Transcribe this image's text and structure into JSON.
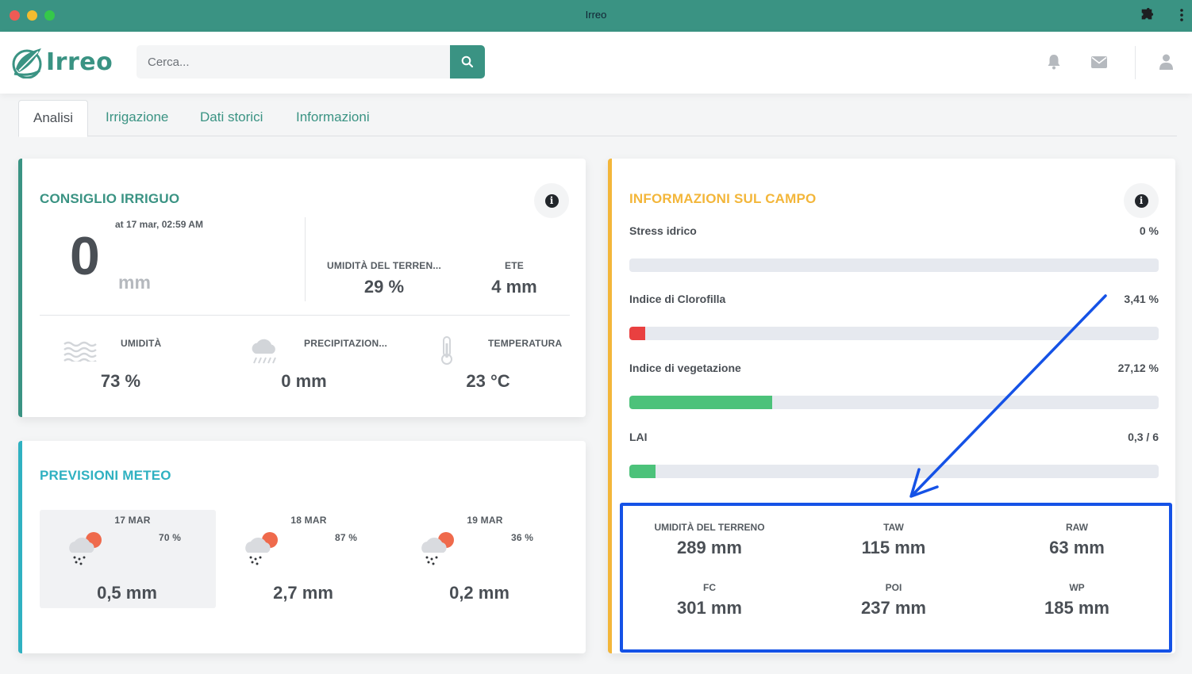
{
  "window": {
    "title": "Irreo"
  },
  "header": {
    "logo_text": "Irreo",
    "search_placeholder": "Cerca...",
    "colors": {
      "brand": "#3a9383"
    }
  },
  "tabs": [
    {
      "label": "Analisi",
      "active": true
    },
    {
      "label": "Irrigazione",
      "active": false
    },
    {
      "label": "Dati storici",
      "active": false
    },
    {
      "label": "Informazioni",
      "active": false
    }
  ],
  "consiglio": {
    "title": "CONSIGLIO IRRIGUO",
    "timestamp": "at 17 mar, 02:59 AM",
    "value": "0",
    "unit": "mm",
    "soil_moisture_label": "UMIDITÀ DEL TERREN...",
    "soil_moisture_value": "29 %",
    "ete_label": "ETE",
    "ete_value": "4 mm",
    "humidity_label": "UMIDITÀ",
    "humidity_value": "73 %",
    "precip_label": "PRECIPITAZION...",
    "precip_value": "0 mm",
    "temp_label": "TEMPERATURA",
    "temp_value": "23 °C",
    "color": "#3a9383"
  },
  "previsioni": {
    "title": "PREVISIONI METEO",
    "color": "#2fb1c1",
    "days": [
      {
        "date": "17 MAR",
        "prob": "70 %",
        "mm": "0,5 mm"
      },
      {
        "date": "18 MAR",
        "prob": "87 %",
        "mm": "2,7 mm"
      },
      {
        "date": "19 MAR",
        "prob": "36 %",
        "mm": "0,2 mm"
      }
    ]
  },
  "campo": {
    "title": "INFORMAZIONI SUL CAMPO",
    "color": "#f3b63a",
    "bars": [
      {
        "label": "Stress idrico",
        "value": "0 %",
        "fill": 0,
        "color": "#e94040"
      },
      {
        "label": "Indice di Clorofilla",
        "value": "3,41 %",
        "fill": 0.03,
        "color": "#e94040"
      },
      {
        "label": "Indice di vegetazione",
        "value": "27,12 %",
        "fill": 0.27,
        "color": "#4cc27a"
      },
      {
        "label": "LAI",
        "value": "0,3 / 6",
        "fill": 0.05,
        "color": "#4cc27a"
      }
    ],
    "stats": [
      {
        "label": "UMIDITÀ DEL TERRENO",
        "value": "289 mm"
      },
      {
        "label": "TAW",
        "value": "115 mm"
      },
      {
        "label": "RAW",
        "value": "63 mm"
      },
      {
        "label": "FC",
        "value": "301 mm"
      },
      {
        "label": "POI",
        "value": "237 mm"
      },
      {
        "label": "WP",
        "value": "185 mm"
      }
    ]
  },
  "annotation": {
    "color": "#1552e6"
  }
}
